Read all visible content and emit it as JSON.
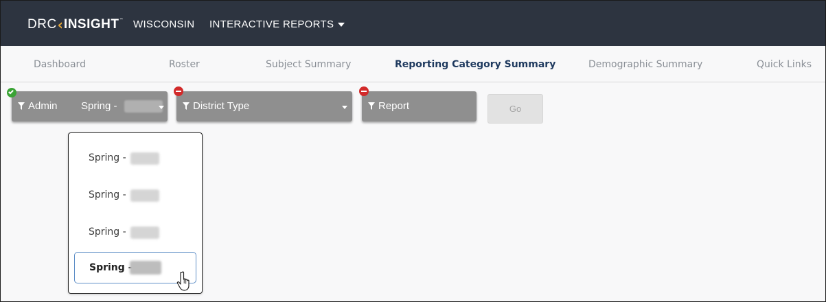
{
  "header": {
    "logo_prefix": "DRC",
    "logo_name": "INSIGHT",
    "logo_tm": "™",
    "state": "WISCONSIN",
    "reports_menu": "INTERACTIVE REPORTS"
  },
  "tabs": [
    {
      "label": "Dashboard"
    },
    {
      "label": "Roster"
    },
    {
      "label": "Subject Summary"
    },
    {
      "label": "Reporting Category Summary"
    },
    {
      "label": "Demographic Summary"
    },
    {
      "label": "Quick Links"
    }
  ],
  "active_tab": "Reporting Category Summary",
  "filters": {
    "admin": {
      "label": "Admin",
      "value": "Spring -",
      "status": "complete"
    },
    "district_type": {
      "label": "District Type",
      "status": "missing"
    },
    "report": {
      "label": "Report",
      "status": "missing"
    }
  },
  "go_button": {
    "label": "Go",
    "enabled": false
  },
  "admin_dropdown": {
    "options": [
      {
        "label": "Spring -"
      },
      {
        "label": "Spring -"
      },
      {
        "label": "Spring -"
      },
      {
        "label": "Spring -",
        "selected": true
      }
    ]
  },
  "colors": {
    "topbar": "#2d3440",
    "accent": "#e8a735",
    "active_tab": "#1f3a5f",
    "filter_bg": "#8f8f8f",
    "ok_badge": "#3aa335",
    "error_badge": "#d22a2a"
  },
  "icons": {
    "filter": "funnel-icon",
    "status_ok": "check-circle-icon",
    "status_error": "minus-circle-icon",
    "cursor": "hand-pointer-icon"
  }
}
